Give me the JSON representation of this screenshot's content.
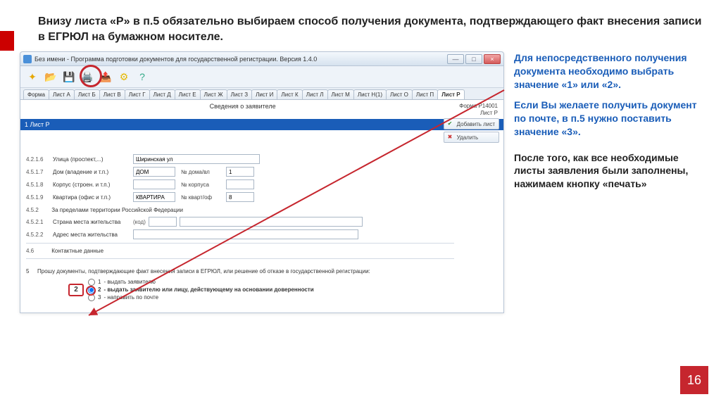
{
  "heading": "Внизу листа «Р» в п.5 обязательно выбираем способ получения документа, подтверждающего факт внесения записи в ЕГРЮЛ на бумажном носителе.",
  "window": {
    "title": "Без имени - Программа подготовки документов для государственной регистрации. Версия 1.4.0",
    "min": "—",
    "max": "□",
    "close": "×"
  },
  "tabs": [
    "Форма",
    "Лист А",
    "Лист Б",
    "Лист В",
    "Лист Г",
    "Лист Д",
    "Лист Е",
    "Лист Ж",
    "Лист З",
    "Лист И",
    "Лист К",
    "Лист Л",
    "Лист М",
    "Лист Н(1)",
    "Лист О",
    "Лист П",
    "Лист Р"
  ],
  "form": {
    "title": "Сведения о заявителе",
    "code": "Форма Р14001",
    "sheet": "Лист Р",
    "row_label": "1 Лист Р",
    "btn_add": "Добавить лист",
    "btn_del": "Удалить"
  },
  "fields": {
    "r1": {
      "num": "4.2.1.6",
      "label": "Улица (проспект,...)",
      "val": "Ширинская ул"
    },
    "r2": {
      "num": "4.5.1.7",
      "label": "Дом (владение и т.п.)",
      "val": "ДОМ",
      "sub": "№ дома/вл",
      "sval": "1"
    },
    "r3": {
      "num": "4.5.1.8",
      "label": "Корпус (строен. и т.п.)",
      "val": "",
      "sub": "№ корпуса",
      "sval": ""
    },
    "r4": {
      "num": "4.5.1.9",
      "label": "Квартира (офис и т.п.)",
      "val": "КВАРТИРА",
      "sub": "№ кварт/оф",
      "sval": "8"
    },
    "s452": {
      "num": "4.5.2",
      "label": "За пределами территории Российской Федерации"
    },
    "r5": {
      "num": "4.5.2.1",
      "label": "Страна места жительства",
      "code": "(код)"
    },
    "r6": {
      "num": "4.5.2.2",
      "label": "Адрес места жительства"
    },
    "s46": {
      "num": "4.6",
      "label": "Контактные данные"
    }
  },
  "p5": {
    "num": "5",
    "text": "Прошу документы, подтверждающие факт внесения записи в ЕГРЮЛ, или решение об отказе в государственной регистрации:",
    "box": "2",
    "opts": [
      {
        "n": "1",
        "t": "- выдать заявителю"
      },
      {
        "n": "2",
        "t": "- выдать заявителю или лицу, действующему на основании доверенности"
      },
      {
        "n": "3",
        "t": "- направить по почте"
      }
    ]
  },
  "side": {
    "p1": "Для непосредственного получения документа необходимо выбрать значение «1» или «2».",
    "p2": "Если Вы желаете получить документ по почте, в п.5 нужно поставить  значение «3».",
    "p3": "После того, как все необходимые листы заявления были заполнены, нажимаем кнопку «печать»"
  },
  "page": "16"
}
